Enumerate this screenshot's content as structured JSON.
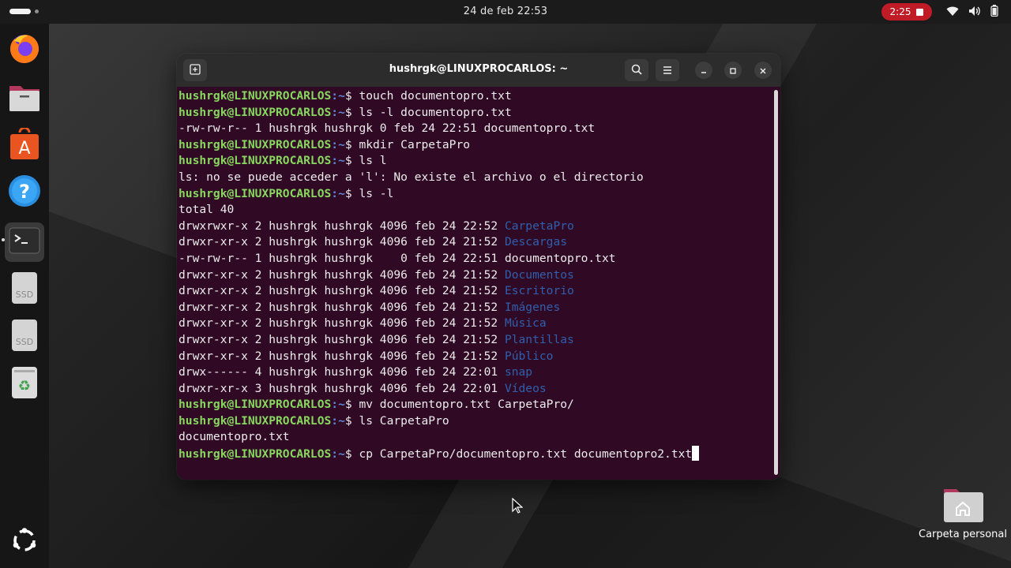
{
  "topbar": {
    "datetime": "24 de feb  22:53",
    "recording_time": "2:25"
  },
  "dock": {
    "items": [
      {
        "name": "Firefox",
        "icon": "firefox-icon"
      },
      {
        "name": "Archivos",
        "icon": "files-icon"
      },
      {
        "name": "App Center",
        "icon": "app-center-icon"
      },
      {
        "name": "Ayuda",
        "icon": "help-icon"
      },
      {
        "name": "Terminal",
        "icon": "terminal-icon",
        "active": true
      },
      {
        "name": "SSD",
        "icon": "drive-icon",
        "label": "SSD"
      },
      {
        "name": "SSD",
        "icon": "drive-icon",
        "label": "SSD"
      },
      {
        "name": "Papelera",
        "icon": "trash-icon"
      },
      {
        "name": "Aplicaciones",
        "icon": "show-apps-icon"
      }
    ]
  },
  "terminal": {
    "title": "hushrgk@LINUXPROCARLOS: ~",
    "prompt_user": "hushrgk@LINUXPROCARLOS",
    "prompt_path": ":~",
    "colors": {
      "background": "#300a24",
      "prompt_user": "#87d75f",
      "prompt_path": "#5f87d7",
      "directory": "#2f5fae"
    },
    "lines": [
      {
        "type": "cmd",
        "text": "$ touch documentopro.txt"
      },
      {
        "type": "cmd",
        "text": "$ ls -l documentopro.txt"
      },
      {
        "type": "out",
        "text": "-rw-rw-r-- 1 hushrgk hushrgk 0 feb 24 22:51 documentopro.txt"
      },
      {
        "type": "cmd",
        "text": "$ mkdir CarpetaPro"
      },
      {
        "type": "cmd",
        "text": "$ ls l"
      },
      {
        "type": "out",
        "text": "ls: no se puede acceder a 'l': No existe el archivo o el directorio"
      },
      {
        "type": "cmd",
        "text": "$ ls -l"
      },
      {
        "type": "out",
        "text": "total 40"
      },
      {
        "type": "entry",
        "text": "drwxrwxr-x 2 hushrgk hushrgk 4096 feb 24 22:52 ",
        "name": "CarpetaPro",
        "dir": true
      },
      {
        "type": "entry",
        "text": "drwxr-xr-x 2 hushrgk hushrgk 4096 feb 24 21:52 ",
        "name": "Descargas",
        "dir": true
      },
      {
        "type": "entry",
        "text": "-rw-rw-r-- 1 hushrgk hushrgk    0 feb 24 22:51 ",
        "name": "documentopro.txt",
        "dir": false
      },
      {
        "type": "entry",
        "text": "drwxr-xr-x 2 hushrgk hushrgk 4096 feb 24 21:52 ",
        "name": "Documentos",
        "dir": true
      },
      {
        "type": "entry",
        "text": "drwxr-xr-x 2 hushrgk hushrgk 4096 feb 24 21:52 ",
        "name": "Escritorio",
        "dir": true
      },
      {
        "type": "entry",
        "text": "drwxr-xr-x 2 hushrgk hushrgk 4096 feb 24 21:52 ",
        "name": "Imágenes",
        "dir": true
      },
      {
        "type": "entry",
        "text": "drwxr-xr-x 2 hushrgk hushrgk 4096 feb 24 21:52 ",
        "name": "Música",
        "dir": true
      },
      {
        "type": "entry",
        "text": "drwxr-xr-x 2 hushrgk hushrgk 4096 feb 24 21:52 ",
        "name": "Plantillas",
        "dir": true
      },
      {
        "type": "entry",
        "text": "drwxr-xr-x 2 hushrgk hushrgk 4096 feb 24 21:52 ",
        "name": "Público",
        "dir": true
      },
      {
        "type": "entry",
        "text": "drwx------ 4 hushrgk hushrgk 4096 feb 24 22:01 ",
        "name": "snap",
        "dir": true
      },
      {
        "type": "entry",
        "text": "drwxr-xr-x 3 hushrgk hushrgk 4096 feb 24 22:01 ",
        "name": "Vídeos",
        "dir": true
      },
      {
        "type": "cmd",
        "text": "$ mv documentopro.txt CarpetaPro/"
      },
      {
        "type": "cmd",
        "text": "$ ls CarpetaPro"
      },
      {
        "type": "out",
        "text": "documentopro.txt"
      },
      {
        "type": "cmd",
        "text": "$ cp CarpetaPro/documentopro.txt documentopro2.txt",
        "cursor": true
      }
    ]
  },
  "desktop": {
    "home_folder_label": "Carpeta personal"
  }
}
